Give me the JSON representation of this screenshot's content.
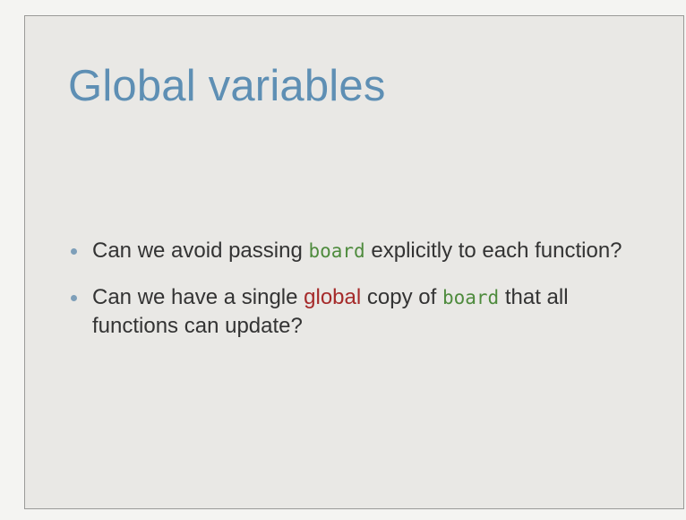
{
  "slide": {
    "title": "Global variables",
    "bullets": [
      {
        "before": "Can we avoid passing ",
        "code": "board",
        "after": " explicitly to each function?"
      },
      {
        "before": "Can we have a single ",
        "emph": "global",
        "middle": " copy of ",
        "code": "board",
        "after": " that all functions can update?"
      }
    ]
  },
  "colors": {
    "title": "#5e8fb4",
    "code": "#4e8b3d",
    "emphasis": "#a52a2a",
    "text": "#333333",
    "bullet": "#7e9fb9",
    "slide_background": "#e9e8e5"
  }
}
